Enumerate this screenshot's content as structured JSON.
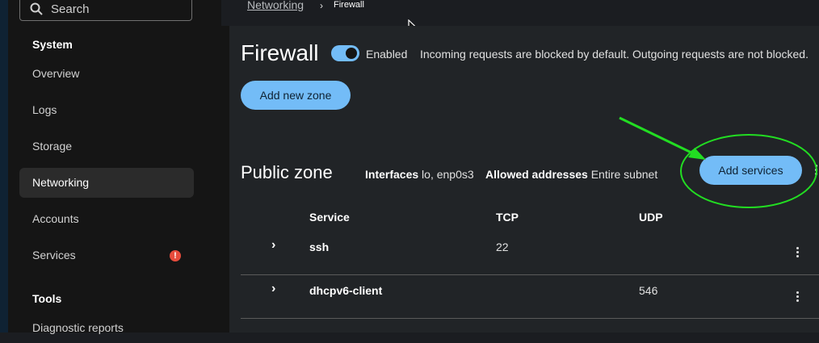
{
  "search": {
    "placeholder": "Search"
  },
  "sidebar": {
    "groups": [
      {
        "title": "System",
        "items": [
          {
            "label": "Overview"
          },
          {
            "label": "Logs"
          },
          {
            "label": "Storage"
          },
          {
            "label": "Networking",
            "active": true
          },
          {
            "label": "Accounts"
          },
          {
            "label": "Services",
            "alert": "!"
          }
        ]
      },
      {
        "title": "Tools",
        "items": [
          {
            "label": "Diagnostic reports"
          }
        ]
      }
    ]
  },
  "breadcrumb": {
    "parent": "Networking",
    "separator": "›",
    "current": "Firewall"
  },
  "firewall": {
    "title": "Firewall",
    "toggle_state": "on",
    "enabled_label": "Enabled",
    "description": "Incoming requests are blocked by default. Outgoing requests are not blocked.",
    "add_zone_label": "Add new zone"
  },
  "zone": {
    "title": "Public zone",
    "interfaces_label": "Interfaces",
    "interfaces_value": "lo, enp0s3",
    "allowed_label": "Allowed addresses",
    "allowed_value": "Entire subnet",
    "add_services_label": "Add services"
  },
  "table": {
    "headers": [
      "Service",
      "TCP",
      "UDP"
    ],
    "rows": [
      {
        "service": "ssh",
        "tcp": "22",
        "udp": ""
      },
      {
        "service": "dhcpv6-client",
        "tcp": "",
        "udp": "546"
      }
    ]
  },
  "colors": {
    "accent": "#73bcf7",
    "annotation": "#22dd22",
    "alert": "#e74c3c"
  }
}
